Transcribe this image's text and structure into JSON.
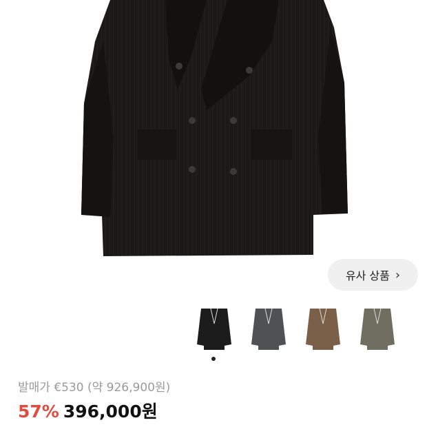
{
  "product_image": {
    "icon": "black-double-breasted-jacket"
  },
  "similar_button": {
    "label": "유사 상품",
    "icon": "chevron-right-icon"
  },
  "color_options": [
    {
      "name": "black",
      "color": "#1c1c1c"
    },
    {
      "name": "charcoal",
      "color": "#505152"
    },
    {
      "name": "brown",
      "color": "#7a5f49"
    },
    {
      "name": "olive",
      "color": "#6f6e61"
    }
  ],
  "carousel": {
    "active_index": 0
  },
  "pricing": {
    "original_label": "발매가 €530 (약 926,900원)",
    "discount": "57%",
    "price": "396,000원"
  }
}
